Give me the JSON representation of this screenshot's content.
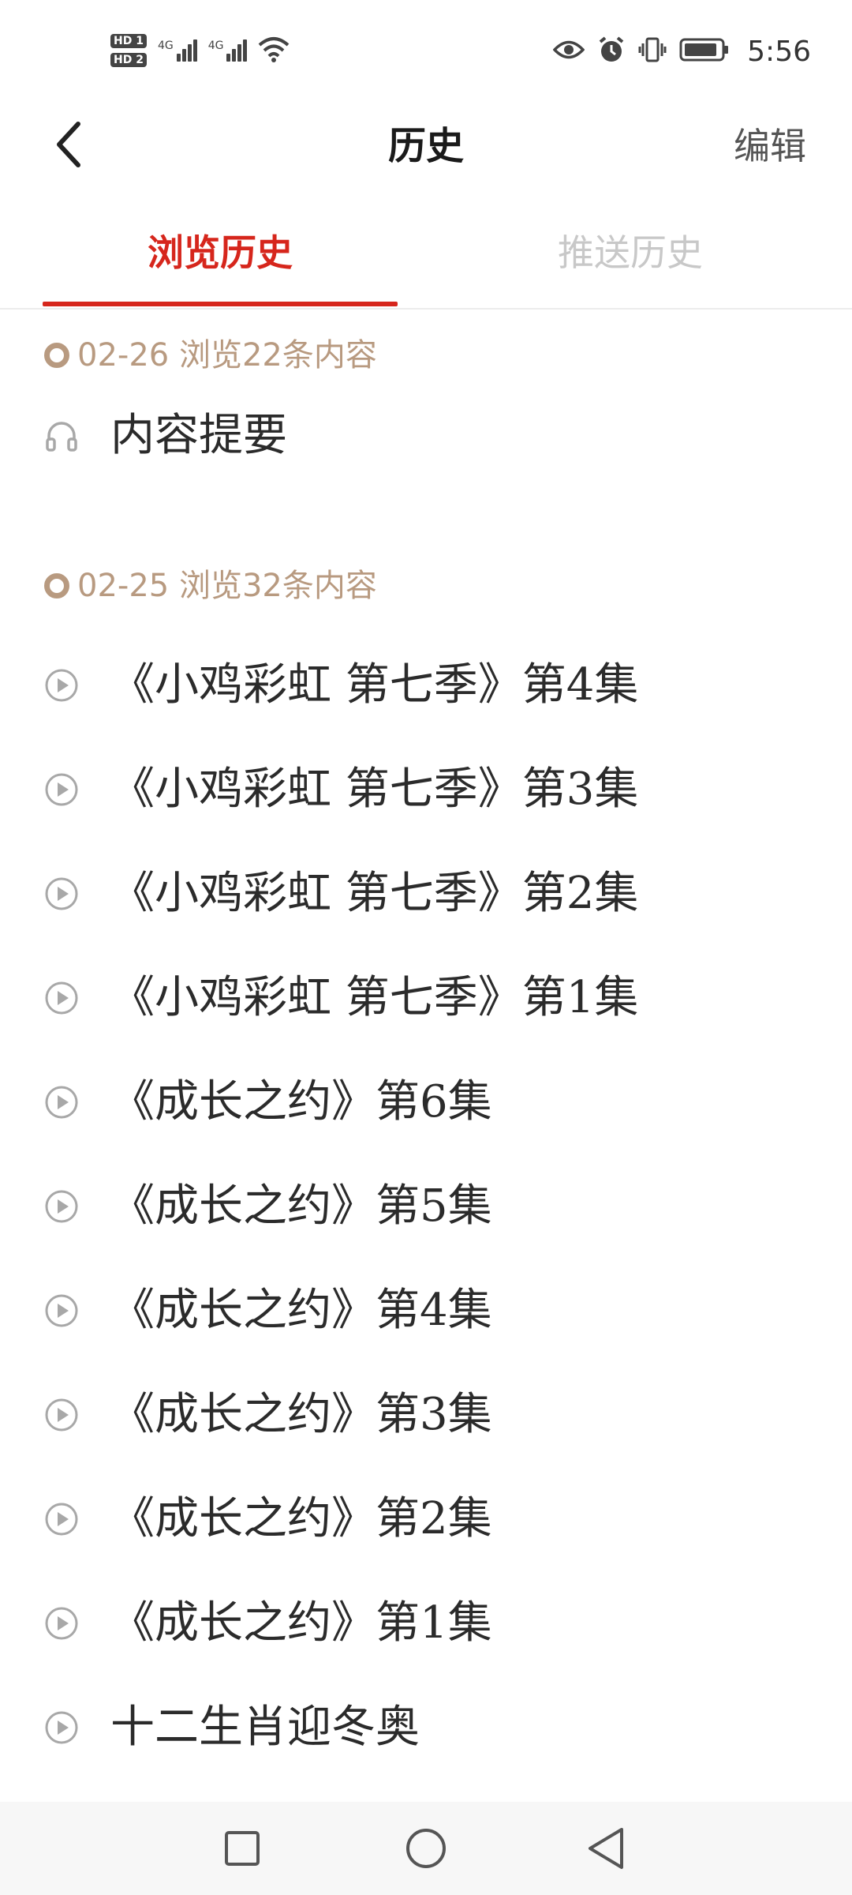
{
  "status_bar": {
    "sim1_badge": "HD 1",
    "sim2_badge": "HD 2",
    "sim1_network": "4G",
    "sim2_network": "4G",
    "time": "5:56",
    "icons": [
      "eye-icon",
      "alarm-icon",
      "vibrate-icon",
      "battery-icon",
      "wifi-icon"
    ]
  },
  "header": {
    "title": "历史",
    "edit_label": "编辑"
  },
  "tabs": [
    {
      "label": "浏览历史",
      "active": true
    },
    {
      "label": "推送历史",
      "active": false
    }
  ],
  "groups": [
    {
      "header": "02-26 浏览22条内容",
      "items": [
        {
          "icon": "headphones-icon",
          "label": "内容提要"
        }
      ]
    },
    {
      "header": "02-25 浏览32条内容",
      "items": [
        {
          "icon": "play-circle-icon",
          "label": "《小鸡彩虹 第七季》第4集"
        },
        {
          "icon": "play-circle-icon",
          "label": "《小鸡彩虹 第七季》第3集"
        },
        {
          "icon": "play-circle-icon",
          "label": "《小鸡彩虹 第七季》第2集"
        },
        {
          "icon": "play-circle-icon",
          "label": "《小鸡彩虹 第七季》第1集"
        },
        {
          "icon": "play-circle-icon",
          "label": "《成长之约》第6集"
        },
        {
          "icon": "play-circle-icon",
          "label": "《成长之约》第5集"
        },
        {
          "icon": "play-circle-icon",
          "label": "《成长之约》第4集"
        },
        {
          "icon": "play-circle-icon",
          "label": "《成长之约》第3集"
        },
        {
          "icon": "play-circle-icon",
          "label": "《成长之约》第2集"
        },
        {
          "icon": "play-circle-icon",
          "label": "《成长之约》第1集"
        },
        {
          "icon": "play-circle-icon",
          "label": "十二生肖迎冬奥"
        }
      ]
    }
  ],
  "colors": {
    "accent": "#d6261c",
    "group_header": "#b89a80",
    "inactive_tab": "#c8c8c8"
  }
}
